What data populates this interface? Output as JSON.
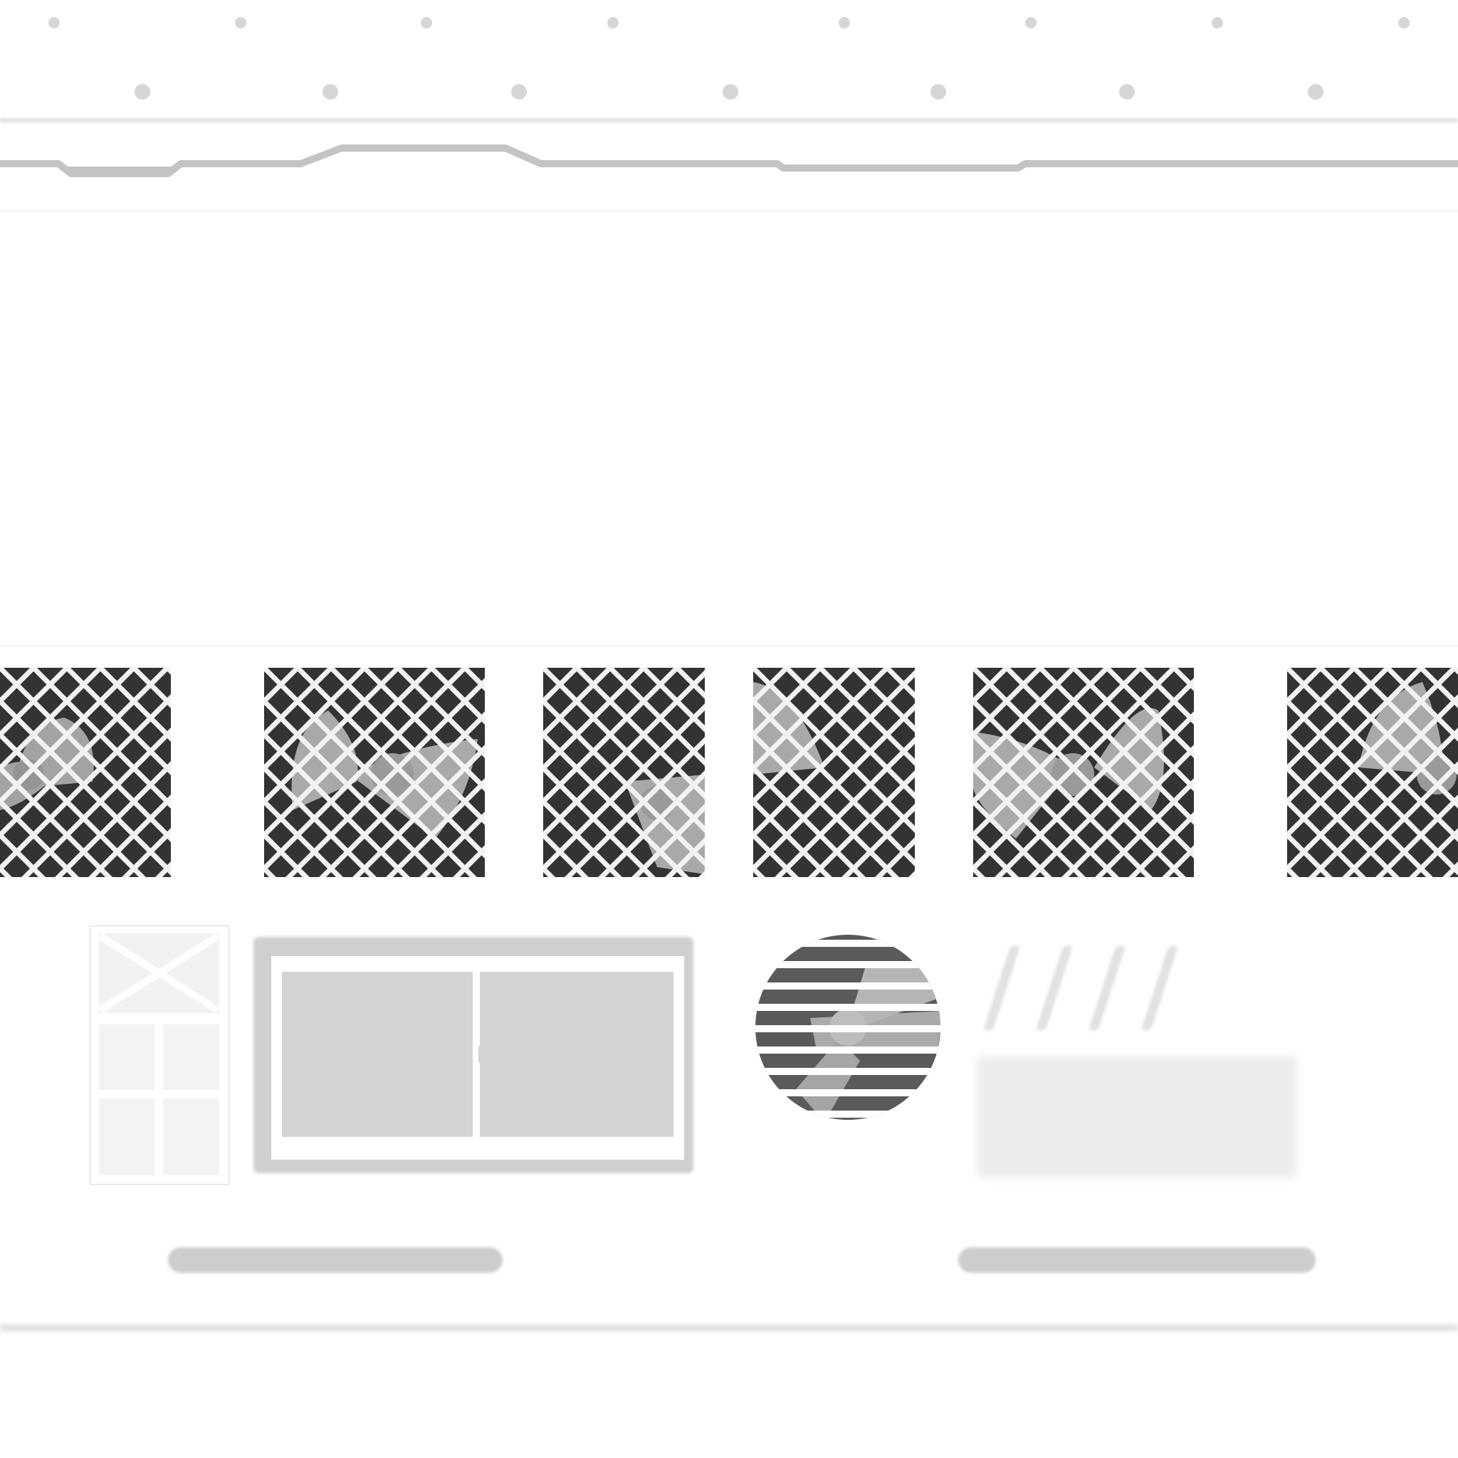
{
  "colors": {
    "background": "#ffffff",
    "dot": "#d6d6d6",
    "rail": "#c4c4c4",
    "tile_dark": "#333333",
    "grille_light": "#f2f2f2",
    "fan_blade": "#a9a9a9",
    "pane": "#d4d4d4",
    "pill": "#cdcdcd"
  },
  "icons": {
    "top_dots": "dot-icon",
    "fan_tiles": "fan-grille-icon",
    "door": "door-icon",
    "window": "sliding-window-icon",
    "round_vent": "round-vent-fan-icon",
    "hatch_marks": "hatch-marks-icon"
  },
  "fan_tiles_count": 6
}
